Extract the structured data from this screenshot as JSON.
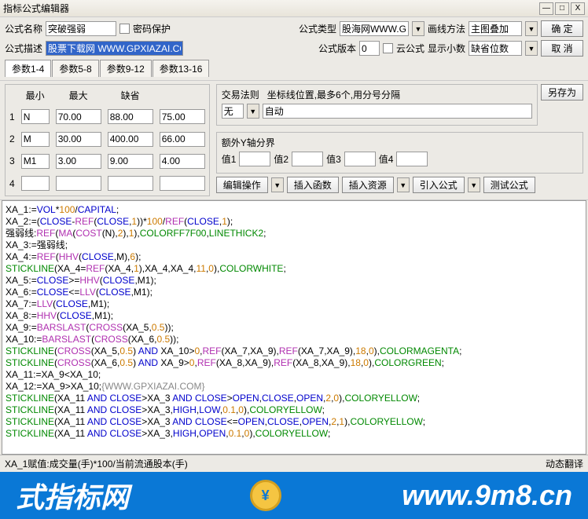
{
  "window": {
    "title": "指标公式编辑器",
    "min": "—",
    "max": "□",
    "close": "X"
  },
  "form": {
    "name_lbl": "公式名称",
    "name_val": "突破强弱",
    "pwd_lbl": "密码保护",
    "type_lbl": "公式类型",
    "type_val": "股海网WWW.GU…",
    "draw_lbl": "画线方法",
    "draw_val": "主图叠加",
    "ok": "确  定",
    "desc_lbl": "公式描述",
    "desc_val": "股票下载网 WWW.GPXIAZAI.COM",
    "ver_lbl": "公式版本",
    "ver_val": "0",
    "cloud_lbl": "云公式",
    "dec_lbl": "显示小数",
    "dec_val": "缺省位数",
    "cancel": "取  消"
  },
  "tabs": [
    "参数1-4",
    "参数5-8",
    "参数9-12",
    "参数13-16"
  ],
  "param_hdr": [
    "",
    "最小",
    "最大",
    "缺省"
  ],
  "params": [
    {
      "n": "1",
      "name": "N",
      "min": "70.00",
      "max": "88.00",
      "def": "75.00"
    },
    {
      "n": "2",
      "name": "M",
      "min": "30.00",
      "max": "400.00",
      "def": "66.00"
    },
    {
      "n": "3",
      "name": "M1",
      "min": "3.00",
      "max": "9.00",
      "def": "4.00"
    },
    {
      "n": "4",
      "name": "",
      "min": "",
      "max": "",
      "def": ""
    }
  ],
  "rules": {
    "title": "交易法则",
    "hint": "坐标线位置,最多6个,用分号分隔",
    "none": "无",
    "auto": "自动",
    "saveas": "另存为"
  },
  "extra": {
    "title": "额外Y轴分界",
    "v1": "值1",
    "v2": "值2",
    "v3": "值3",
    "v4": "值4"
  },
  "btns": {
    "edit": "编辑操作",
    "func": "插入函数",
    "res": "插入资源",
    "imp": "引入公式",
    "test": "测试公式"
  },
  "status": {
    "left": "XA_1赋值:成交量(手)*100/当前流通股本(手)",
    "right": "动态翻译"
  },
  "banner": {
    "cn": "式指标网",
    "url": "www.9m8.cn"
  },
  "code": [
    [
      [
        "XA_1:=",
        "blk"
      ],
      [
        "VOL",
        "kw"
      ],
      [
        "*",
        "blk"
      ],
      [
        "100",
        "num"
      ],
      [
        "/",
        "blk"
      ],
      [
        "CAPITAL",
        "kw"
      ],
      [
        ";",
        "blk"
      ]
    ],
    [
      [
        "XA_2:=(",
        "blk"
      ],
      [
        "CLOSE",
        "kw"
      ],
      [
        "-",
        "blk"
      ],
      [
        "REF",
        "fn"
      ],
      [
        "(",
        "blk"
      ],
      [
        "CLOSE",
        "kw"
      ],
      [
        ",",
        "blk"
      ],
      [
        "1",
        "num"
      ],
      [
        "))*",
        "blk"
      ],
      [
        "100",
        "num"
      ],
      [
        "/",
        "blk"
      ],
      [
        "REF",
        "fn"
      ],
      [
        "(",
        "blk"
      ],
      [
        "CLOSE",
        "kw"
      ],
      [
        ",",
        "blk"
      ],
      [
        "1",
        "num"
      ],
      [
        ");",
        "blk"
      ]
    ],
    [
      [
        "强弱线:",
        "blk"
      ],
      [
        "REF",
        "fn"
      ],
      [
        "(",
        "blk"
      ],
      [
        "MA",
        "fn"
      ],
      [
        "(",
        "blk"
      ],
      [
        "COST",
        "fn"
      ],
      [
        "(N),",
        "blk"
      ],
      [
        "2",
        "num"
      ],
      [
        "),",
        "blk"
      ],
      [
        "1",
        "num"
      ],
      [
        "),",
        "blk"
      ],
      [
        "COLORFF7F00",
        "grn"
      ],
      [
        ",",
        "blk"
      ],
      [
        "LINETHICK2",
        "grn"
      ],
      [
        ";",
        "blk"
      ]
    ],
    [
      [
        "XA_3:=强弱线;",
        "blk"
      ]
    ],
    [
      [
        "XA_4:=",
        "blk"
      ],
      [
        "REF",
        "fn"
      ],
      [
        "(",
        "blk"
      ],
      [
        "HHV",
        "fn"
      ],
      [
        "(",
        "blk"
      ],
      [
        "CLOSE",
        "kw"
      ],
      [
        ",M),",
        "blk"
      ],
      [
        "6",
        "num"
      ],
      [
        ");",
        "blk"
      ]
    ],
    [
      [
        "STICKLINE",
        "grn"
      ],
      [
        "(XA_4=",
        "blk"
      ],
      [
        "REF",
        "fn"
      ],
      [
        "(XA_4,",
        "blk"
      ],
      [
        "1",
        "num"
      ],
      [
        "),XA_4,XA_4,",
        "blk"
      ],
      [
        "11",
        "num"
      ],
      [
        ",",
        "blk"
      ],
      [
        "0",
        "num"
      ],
      [
        "),",
        "blk"
      ],
      [
        "COLORWHITE",
        "grn"
      ],
      [
        ";",
        "blk"
      ]
    ],
    [
      [
        "XA_5:=",
        "blk"
      ],
      [
        "CLOSE",
        "kw"
      ],
      [
        ">=",
        "blk"
      ],
      [
        "HHV",
        "fn"
      ],
      [
        "(",
        "blk"
      ],
      [
        "CLOSE",
        "kw"
      ],
      [
        ",M1);",
        "blk"
      ]
    ],
    [
      [
        "XA_6:=",
        "blk"
      ],
      [
        "CLOSE",
        "kw"
      ],
      [
        "<=",
        "blk"
      ],
      [
        "LLV",
        "fn"
      ],
      [
        "(",
        "blk"
      ],
      [
        "CLOSE",
        "kw"
      ],
      [
        ",M1);",
        "blk"
      ]
    ],
    [
      [
        "XA_7:=",
        "blk"
      ],
      [
        "LLV",
        "fn"
      ],
      [
        "(",
        "blk"
      ],
      [
        "CLOSE",
        "kw"
      ],
      [
        ",M1);",
        "blk"
      ]
    ],
    [
      [
        "XA_8:=",
        "blk"
      ],
      [
        "HHV",
        "fn"
      ],
      [
        "(",
        "blk"
      ],
      [
        "CLOSE",
        "kw"
      ],
      [
        ",M1);",
        "blk"
      ]
    ],
    [
      [
        "XA_9:=",
        "blk"
      ],
      [
        "BARSLAST",
        "fn"
      ],
      [
        "(",
        "blk"
      ],
      [
        "CROSS",
        "fn"
      ],
      [
        "(XA_5,",
        "blk"
      ],
      [
        "0.5",
        "num"
      ],
      [
        "));",
        "blk"
      ]
    ],
    [
      [
        "XA_10:=",
        "blk"
      ],
      [
        "BARSLAST",
        "fn"
      ],
      [
        "(",
        "blk"
      ],
      [
        "CROSS",
        "fn"
      ],
      [
        "(XA_6,",
        "blk"
      ],
      [
        "0.5",
        "num"
      ],
      [
        "));",
        "blk"
      ]
    ],
    [
      [
        "STICKLINE",
        "grn"
      ],
      [
        "(",
        "blk"
      ],
      [
        "CROSS",
        "fn"
      ],
      [
        "(XA_5,",
        "blk"
      ],
      [
        "0.5",
        "num"
      ],
      [
        ") ",
        "blk"
      ],
      [
        "AND",
        "kw"
      ],
      [
        " XA_10>",
        "blk"
      ],
      [
        "0",
        "num"
      ],
      [
        ",",
        "blk"
      ],
      [
        "REF",
        "fn"
      ],
      [
        "(XA_7,XA_9),",
        "blk"
      ],
      [
        "REF",
        "fn"
      ],
      [
        "(XA_7,XA_9),",
        "blk"
      ],
      [
        "18",
        "num"
      ],
      [
        ",",
        "blk"
      ],
      [
        "0",
        "num"
      ],
      [
        "),",
        "blk"
      ],
      [
        "COLORMAGENTA",
        "grn"
      ],
      [
        ";",
        "blk"
      ]
    ],
    [
      [
        "STICKLINE",
        "grn"
      ],
      [
        "(",
        "blk"
      ],
      [
        "CROSS",
        "fn"
      ],
      [
        "(XA_6,",
        "blk"
      ],
      [
        "0.5",
        "num"
      ],
      [
        ") ",
        "blk"
      ],
      [
        "AND",
        "kw"
      ],
      [
        " XA_9>",
        "blk"
      ],
      [
        "0",
        "num"
      ],
      [
        ",",
        "blk"
      ],
      [
        "REF",
        "fn"
      ],
      [
        "(XA_8,XA_9),",
        "blk"
      ],
      [
        "REF",
        "fn"
      ],
      [
        "(XA_8,XA_9),",
        "blk"
      ],
      [
        "18",
        "num"
      ],
      [
        ",",
        "blk"
      ],
      [
        "0",
        "num"
      ],
      [
        "),",
        "blk"
      ],
      [
        "COLORGREEN",
        "grn"
      ],
      [
        ";",
        "blk"
      ]
    ],
    [
      [
        "XA_11:=XA_9<XA_10;",
        "blk"
      ]
    ],
    [
      [
        "XA_12:=XA_9>XA_10;",
        "blk"
      ],
      [
        "{WWW.GPXIAZAI.COM}",
        "str"
      ]
    ],
    [
      [
        "STICKLINE",
        "grn"
      ],
      [
        "(XA_11 ",
        "blk"
      ],
      [
        "AND",
        "kw"
      ],
      [
        " ",
        "blk"
      ],
      [
        "CLOSE",
        "kw"
      ],
      [
        ">XA_3 ",
        "blk"
      ],
      [
        "AND",
        "kw"
      ],
      [
        " ",
        "blk"
      ],
      [
        "CLOSE",
        "kw"
      ],
      [
        ">",
        "blk"
      ],
      [
        "OPEN",
        "kw"
      ],
      [
        ",",
        "blk"
      ],
      [
        "CLOSE",
        "kw"
      ],
      [
        ",",
        "blk"
      ],
      [
        "OPEN",
        "kw"
      ],
      [
        ",",
        "blk"
      ],
      [
        "2",
        "num"
      ],
      [
        ",",
        "blk"
      ],
      [
        "0",
        "num"
      ],
      [
        "),",
        "blk"
      ],
      [
        "COLORYELLOW",
        "grn"
      ],
      [
        ";",
        "blk"
      ]
    ],
    [
      [
        "STICKLINE",
        "grn"
      ],
      [
        "(XA_11 ",
        "blk"
      ],
      [
        "AND",
        "kw"
      ],
      [
        " ",
        "blk"
      ],
      [
        "CLOSE",
        "kw"
      ],
      [
        ">XA_3,",
        "blk"
      ],
      [
        "HIGH",
        "kw"
      ],
      [
        ",",
        "blk"
      ],
      [
        "LOW",
        "kw"
      ],
      [
        ",",
        "blk"
      ],
      [
        "0.1",
        "num"
      ],
      [
        ",",
        "blk"
      ],
      [
        "0",
        "num"
      ],
      [
        "),",
        "blk"
      ],
      [
        "COLORYELLOW",
        "grn"
      ],
      [
        ";",
        "blk"
      ]
    ],
    [
      [
        "STICKLINE",
        "grn"
      ],
      [
        "(XA_11 ",
        "blk"
      ],
      [
        "AND",
        "kw"
      ],
      [
        " ",
        "blk"
      ],
      [
        "CLOSE",
        "kw"
      ],
      [
        ">XA_3 ",
        "blk"
      ],
      [
        "AND",
        "kw"
      ],
      [
        " ",
        "blk"
      ],
      [
        "CLOSE",
        "kw"
      ],
      [
        "<=",
        "blk"
      ],
      [
        "OPEN",
        "kw"
      ],
      [
        ",",
        "blk"
      ],
      [
        "CLOSE",
        "kw"
      ],
      [
        ",",
        "blk"
      ],
      [
        "OPEN",
        "kw"
      ],
      [
        ",",
        "blk"
      ],
      [
        "2",
        "num"
      ],
      [
        ",",
        "blk"
      ],
      [
        "1",
        "num"
      ],
      [
        "),",
        "blk"
      ],
      [
        "COLORYELLOW",
        "grn"
      ],
      [
        ";",
        "blk"
      ]
    ],
    [
      [
        "STICKLINE",
        "grn"
      ],
      [
        "(XA_11 ",
        "blk"
      ],
      [
        "AND",
        "kw"
      ],
      [
        " ",
        "blk"
      ],
      [
        "CLOSE",
        "kw"
      ],
      [
        ">XA_3,",
        "blk"
      ],
      [
        "HIGH",
        "kw"
      ],
      [
        ",",
        "blk"
      ],
      [
        "OPEN",
        "kw"
      ],
      [
        ",",
        "blk"
      ],
      [
        "0.1",
        "num"
      ],
      [
        ",",
        "blk"
      ],
      [
        "0",
        "num"
      ],
      [
        "),",
        "blk"
      ],
      [
        "COLORYELLOW",
        "grn"
      ],
      [
        ";",
        "blk"
      ]
    ]
  ]
}
